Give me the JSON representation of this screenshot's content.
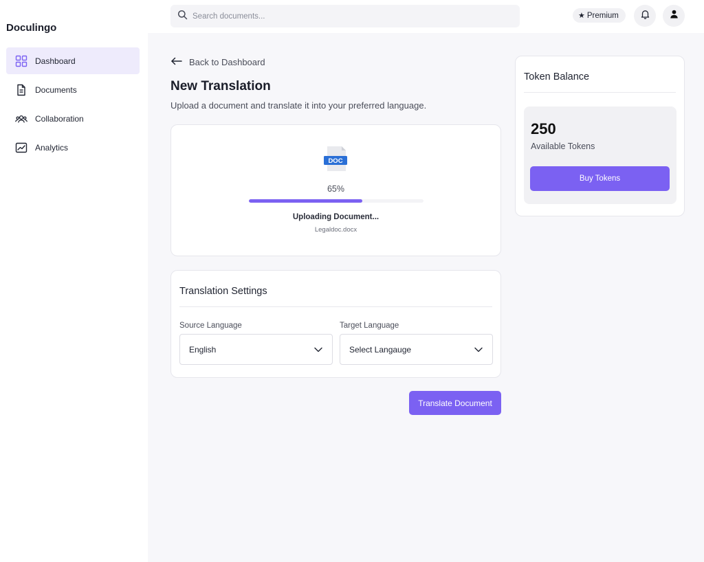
{
  "app": {
    "name": "Doculingo"
  },
  "sidebar": {
    "items": [
      {
        "label": "Dashboard",
        "icon": "grid-icon",
        "active": true
      },
      {
        "label": "Documents",
        "icon": "document-icon",
        "active": false
      },
      {
        "label": "Collaboration",
        "icon": "users-icon",
        "active": false
      },
      {
        "label": "Analytics",
        "icon": "chart-icon",
        "active": false
      }
    ]
  },
  "topbar": {
    "search_placeholder": "Search documents...",
    "premium_label": "Premium"
  },
  "main": {
    "back_label": "Back to Dashboard",
    "title": "New Translation",
    "subtitle": "Upload a document and translate it into your preferred language.",
    "upload": {
      "file_type_badge": "DOC",
      "progress_percent": 65,
      "progress_label": "65%",
      "status": "Uploading Document...",
      "file_name": "Legaldoc.docx"
    },
    "settings": {
      "title": "Translation Settings",
      "source_label": "Source Language",
      "source_value": "English",
      "target_label": "Target Language",
      "target_value": "Select Langauge"
    },
    "translate_button": "Translate Document"
  },
  "tokens": {
    "title": "Token Balance",
    "count": "250",
    "label": "Available Tokens",
    "buy_button": "Buy Tokens"
  },
  "colors": {
    "accent": "#7b61f2",
    "active_nav_bg": "#eeebfc",
    "doc_badge": "#2a6fd6"
  }
}
